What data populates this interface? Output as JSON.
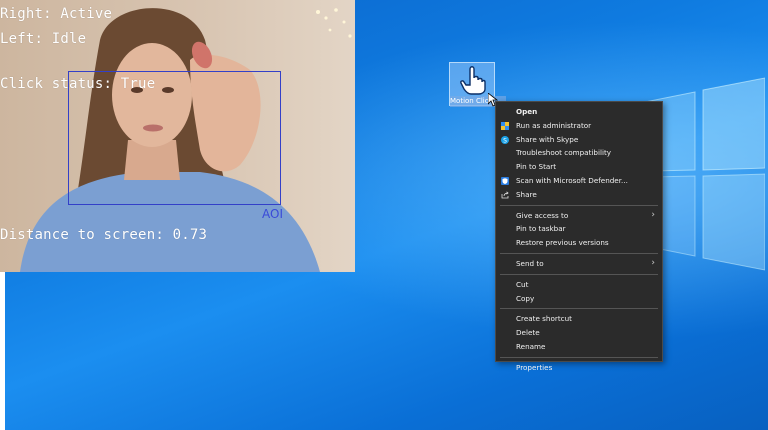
{
  "camera_overlay": {
    "right_eye": "Right: Active",
    "left_eye": "Left: Idle",
    "click_status": "Click status: True",
    "distance": "Distance to screen: 0.73",
    "aoi_label": "AOI"
  },
  "desktop_icon": {
    "label": "Motion Click",
    "icon": "hand-pointer-icon"
  },
  "context_menu": {
    "items": [
      {
        "label": "Open",
        "bold": true
      },
      {
        "label": "Run as administrator",
        "icon": "admin-shield-icon"
      },
      {
        "label": "Share with Skype",
        "icon": "skype-icon"
      },
      {
        "label": "Troubleshoot compatibility"
      },
      {
        "label": "Pin to Start"
      },
      {
        "label": "Scan with Microsoft Defender...",
        "icon": "defender-icon"
      },
      {
        "label": "Share",
        "icon": "share-icon"
      },
      {
        "separator": true
      },
      {
        "label": "Give access to",
        "submenu": true
      },
      {
        "label": "Pin to taskbar"
      },
      {
        "label": "Restore previous versions"
      },
      {
        "separator": true
      },
      {
        "label": "Send to",
        "submenu": true
      },
      {
        "separator": true
      },
      {
        "label": "Cut"
      },
      {
        "label": "Copy"
      },
      {
        "separator": true
      },
      {
        "label": "Create shortcut"
      },
      {
        "label": "Delete"
      },
      {
        "label": "Rename"
      },
      {
        "separator": true
      },
      {
        "label": "Properties"
      }
    ]
  },
  "colors": {
    "desktop_blue": "#0f7be0",
    "menu_bg": "#2b2b2b",
    "aoi_blue": "#3340c8"
  }
}
